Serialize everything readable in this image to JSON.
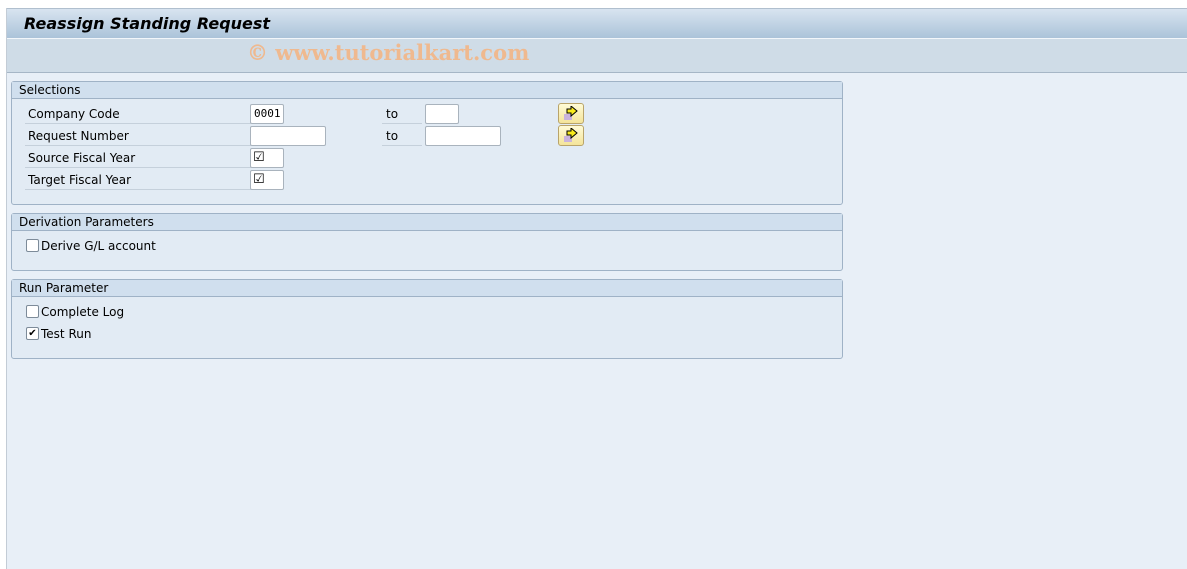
{
  "window": {
    "title": "Reassign Standing Request",
    "watermark": "© www.tutorialkart.com"
  },
  "selections": {
    "header": "Selections",
    "company_code": {
      "label": "Company Code",
      "from": "0001",
      "to_label": "to",
      "to": ""
    },
    "request_number": {
      "label": "Request Number",
      "from": "",
      "to_label": "to",
      "to": ""
    },
    "source_fiscal_year": {
      "label": "Source Fiscal Year",
      "checked": true,
      "glyph": "☑"
    },
    "target_fiscal_year": {
      "label": "Target Fiscal Year",
      "checked": true,
      "glyph": "☑"
    }
  },
  "derivation": {
    "header": "Derivation Parameters",
    "derive_gl": {
      "label": "Derive G/L account",
      "checked": false,
      "glyph": ""
    }
  },
  "run": {
    "header": "Run Parameter",
    "complete_log": {
      "label": "Complete Log",
      "checked": false,
      "glyph": ""
    },
    "test_run": {
      "label": "Test Run",
      "checked": true,
      "glyph": "✔"
    }
  },
  "icons": {
    "multiple_selection": "multiple-selection-arrow-icon"
  }
}
